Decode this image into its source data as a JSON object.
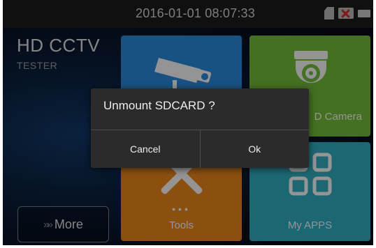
{
  "status_bar": {
    "datetime": "2016-01-01 08:07:33",
    "icons": [
      "sdcard-icon",
      "network-disconnected-icon",
      "battery-icon"
    ]
  },
  "brand": {
    "title": "HD CCTV",
    "subtitle": "TESTER"
  },
  "tiles": [
    {
      "name": "ipc",
      "label": "",
      "color": "#2a8ee0",
      "icon": "cctv-camera-icon"
    },
    {
      "name": "hd-camera",
      "label": "D Camera",
      "color": "#74c23a",
      "icon": "dome-camera-icon"
    },
    {
      "name": "tools",
      "label": "Tools",
      "color": "#ef8a1c",
      "icon": "tools-icon"
    },
    {
      "name": "my-apps",
      "label": "My APPS",
      "color": "#2fb3c4",
      "icon": "apps-grid-icon"
    }
  ],
  "tools_dots": "•••",
  "more_button": {
    "chevrons": "»»",
    "label": "More"
  },
  "dialog": {
    "title": "Unmount SDCARD ?",
    "cancel_label": "Cancel",
    "ok_label": "Ok"
  }
}
